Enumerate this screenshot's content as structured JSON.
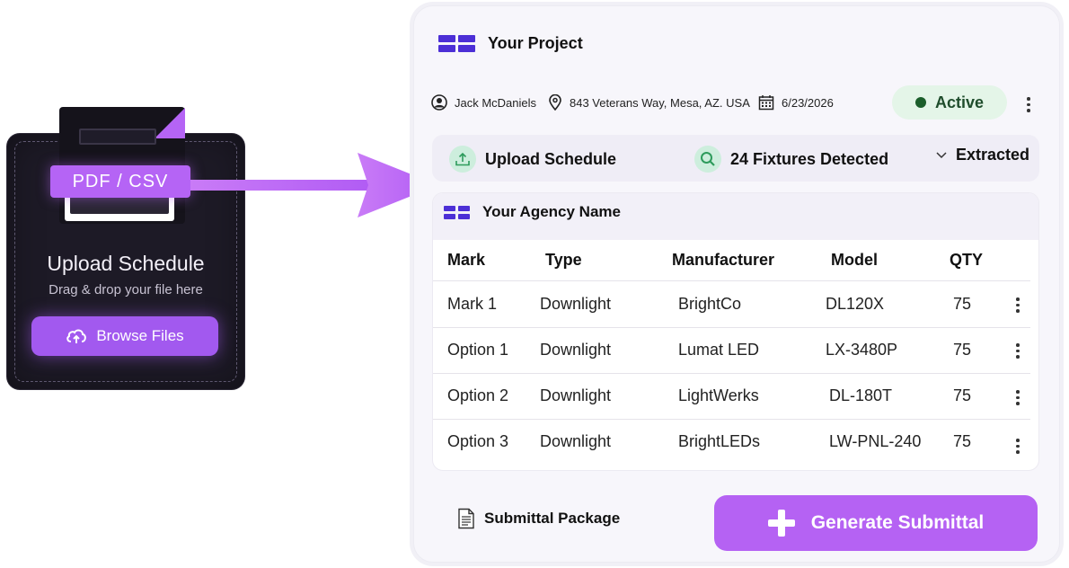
{
  "upload": {
    "badge": "PDF / CSV",
    "title": "Upload Schedule",
    "subtitle": "Drag & drop your file here",
    "browse_label": "Browse Files"
  },
  "project": {
    "title": "Your Project",
    "user": "Jack McDaniels",
    "address": "843 Veterans Way, Mesa, AZ. USA",
    "date": "6/23/2026",
    "status": "Active",
    "status_color": "#1b5e2b"
  },
  "status_bar": {
    "upload": "Upload Schedule",
    "fixtures": "24 Fixtures Detected",
    "extracted": "Extracted"
  },
  "agency": {
    "name": "Your Agency Name"
  },
  "table": {
    "columns": [
      "Mark",
      "Type",
      "Manufacturer",
      "Model",
      "QTY"
    ],
    "rows": [
      [
        "Mark 1",
        "Downlight",
        "BrightCo",
        "DL120X",
        "75"
      ],
      [
        "Option 1",
        "Downlight",
        "Lumat LED",
        "LX-3480P",
        "75"
      ],
      [
        "Option 2",
        "Downlight",
        "LightWerks",
        "DL-180T",
        "75"
      ],
      [
        "Option 3",
        "Downlight",
        "BrightLEDs",
        "LW-PNL-240",
        "75"
      ]
    ]
  },
  "footer": {
    "package_label": "Submittal Package",
    "generate_label": "Generate Submittal"
  },
  "colors": {
    "accent": "#b564f5",
    "brand": "#4c2fd6",
    "active_bg": "#e4f5e8"
  }
}
